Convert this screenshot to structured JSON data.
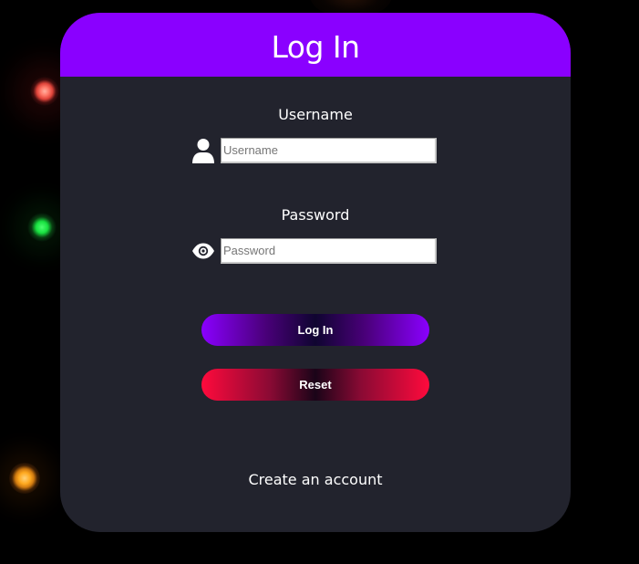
{
  "login_form": {
    "title": "Log In",
    "username": {
      "label": "Username",
      "placeholder": "Username",
      "value": "",
      "icon": "user-icon"
    },
    "password": {
      "label": "Password",
      "placeholder": "Password",
      "value": "",
      "icon": "eye-icon"
    },
    "login_button_label": "Log In",
    "reset_button_label": "Reset",
    "create_account_label": "Create an account"
  },
  "colors": {
    "background": "#000000",
    "card": "#22232d",
    "header": "#8a00ff",
    "login_gradient_edge": "#8a00ff",
    "reset_gradient_edge": "#ff0a3c",
    "text": "#ffffff",
    "glow_red": "#e0443a",
    "glow_green": "#18e040",
    "glow_orange": "#ffa91f"
  }
}
